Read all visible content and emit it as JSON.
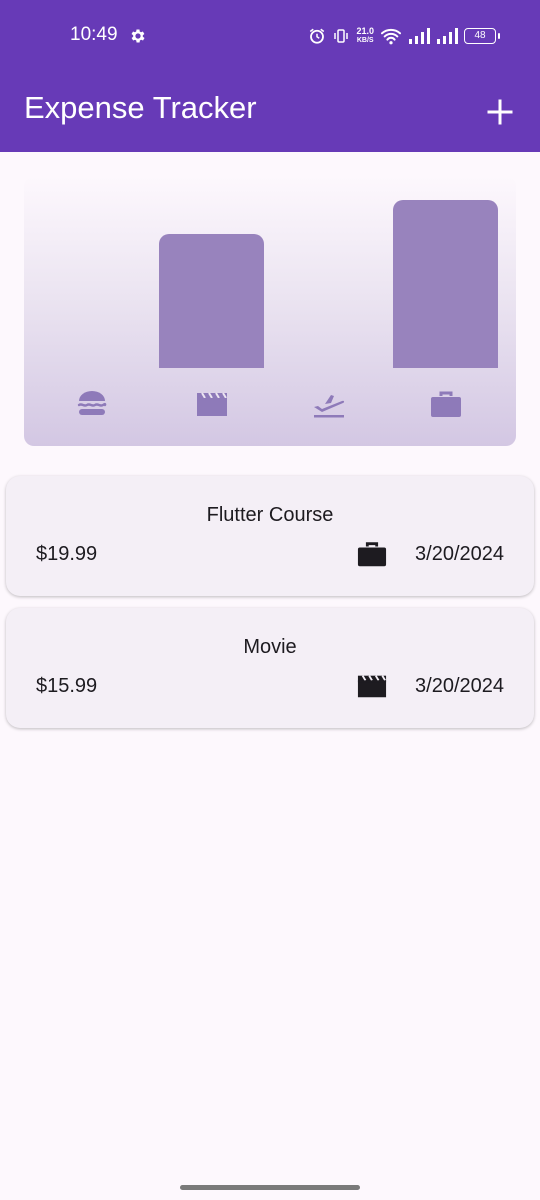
{
  "status_bar": {
    "time": "10:49",
    "net_speed_value": "21.0",
    "net_speed_unit": "KB/S",
    "battery": "48"
  },
  "app_bar": {
    "title": "Expense Tracker",
    "add_icon": "add-icon"
  },
  "chart_data": {
    "type": "bar",
    "categories": [
      "food",
      "leisure",
      "travel",
      "work"
    ],
    "category_icons": [
      "burger-icon",
      "movie-clapper-icon",
      "flight-takeoff-icon",
      "briefcase-icon"
    ],
    "values": [
      0,
      15.99,
      0,
      19.99
    ],
    "bar_color": "#9883bd"
  },
  "expenses": [
    {
      "title": "Flutter Course",
      "amount": "$19.99",
      "date": "3/20/2024",
      "category_icon": "briefcase-icon"
    },
    {
      "title": "Movie",
      "amount": "$15.99",
      "date": "3/20/2024",
      "category_icon": "movie-clapper-icon"
    }
  ],
  "colors": {
    "primary": "#673ab7",
    "background": "#fdf8fd",
    "card": "#f4eff6"
  }
}
